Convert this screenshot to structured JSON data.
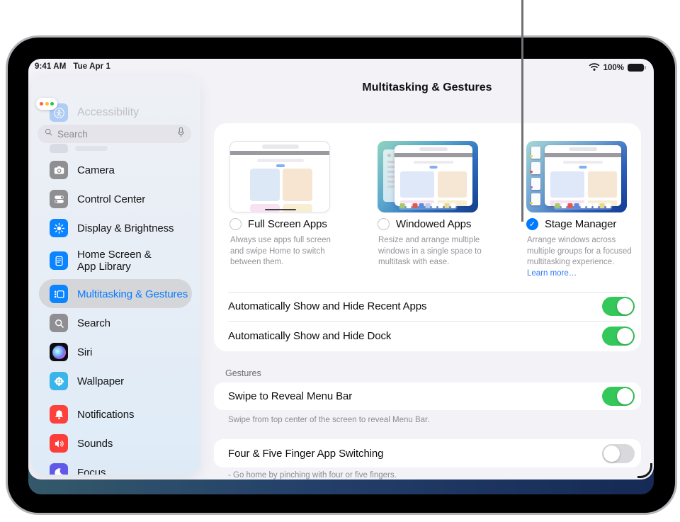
{
  "status_bar": {
    "time": "9:41 AM",
    "date": "Tue Apr 1",
    "battery_percent": "100%"
  },
  "window_title": "Multitasking & Gestures",
  "sidebar": {
    "ghost_item_label": "Accessibility",
    "search_placeholder": "Search",
    "items": [
      {
        "label": "Camera"
      },
      {
        "label": "Control Center"
      },
      {
        "label": "Display & Brightness"
      },
      {
        "label": "Home Screen &",
        "label2": "App Library"
      },
      {
        "label": "Multitasking & Gestures",
        "selected": true
      },
      {
        "label": "Search"
      },
      {
        "label": "Siri"
      },
      {
        "label": "Wallpaper"
      },
      {
        "label": "Notifications"
      },
      {
        "label": "Sounds"
      },
      {
        "label": "Focus"
      }
    ]
  },
  "options": [
    {
      "label": "Full Screen Apps",
      "selected": false,
      "description": "Always use apps full screen and swipe Home to switch between them."
    },
    {
      "label": "Windowed Apps",
      "selected": false,
      "description": "Resize and arrange multiple windows in a single space to multitask with ease."
    },
    {
      "label": "Stage Manager",
      "selected": true,
      "check": "✓",
      "description": "Arrange windows across multiple groups for a focused multitasking experience. ",
      "link_label": "Learn more…"
    }
  ],
  "toggles": [
    {
      "label": "Automatically Show and Hide Recent Apps",
      "on": true
    },
    {
      "label": "Automatically Show and Hide Dock",
      "on": true
    }
  ],
  "gestures": {
    "section_label": "Gestures",
    "rows": [
      {
        "label": "Swipe to Reveal Menu Bar",
        "on": true,
        "footer": "Swipe from top center of the screen to reveal Menu Bar."
      },
      {
        "label": "Four & Five Finger App Switching",
        "on": false,
        "footer": "- Go home by pinching with four or five fingers."
      }
    ]
  },
  "colors": {
    "accent": "#007aff",
    "toggle_on": "#34c759",
    "selected_text": "#0a7bff"
  }
}
